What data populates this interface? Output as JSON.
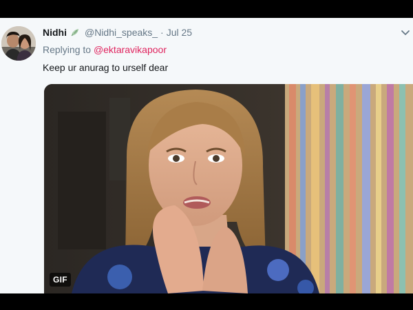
{
  "tweet": {
    "display_name": "Nidhi",
    "handle": "@Nidhi_speaks_",
    "separator": "·",
    "date": "Jul 25",
    "reply_prefix": "Replying to",
    "reply_to": "@ektaravikapoor",
    "text": "Keep ur anurag to urself dear",
    "media_badge": "GIF",
    "icons": {
      "name_emoji": "leaf-icon",
      "menu": "chevron-down-icon"
    }
  },
  "colors": {
    "background": "#f5f8fa",
    "name": "#14171a",
    "muted": "#657786",
    "mention": "#e0245e"
  }
}
